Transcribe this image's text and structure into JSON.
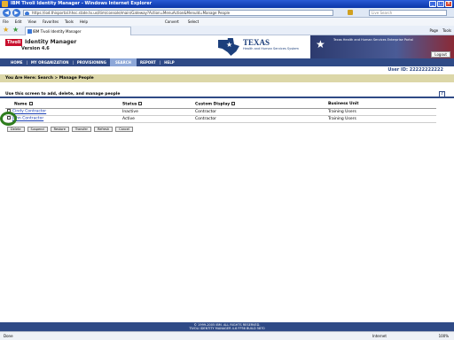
{
  "window": {
    "title": "IBM Tivoli Identity Manager - Windows Internet Explorer"
  },
  "browser": {
    "url": "https://iod.thisportal.hhsc.state.tx.us/itim/console/main/Gateway?Action=MenuAction&MenuId=Manage People",
    "search_placeholder": "Live Search",
    "menu": [
      "File",
      "Edit",
      "View",
      "Favorites",
      "Tools",
      "Help"
    ],
    "toolbar": [
      "Convert",
      "Select"
    ],
    "tab_title": "IBM Tivoli Identity Manager",
    "commands": [
      "Page",
      "Tools"
    ]
  },
  "header": {
    "brand": "Tivoli",
    "app_title": "Identity Manager",
    "version": "Version 4.6",
    "texas_title": "TEXAS",
    "texas_sub": "Health and Human Services System",
    "banner_text": "Texas Health and Human Services Enterprise Portal",
    "logout": "Logout"
  },
  "nav": {
    "items": [
      "HOME",
      "MY ORGANIZATION",
      "PROVISIONING",
      "SEARCH",
      "REPORT",
      "HELP"
    ]
  },
  "user_id": "User ID: 22222222222",
  "breadcrumb": "You Are Here: Search > Manage People",
  "description": "Use this screen to add, delete, and manage people",
  "table": {
    "headers": [
      "Name",
      "Status",
      "Custom Display",
      "Business Unit"
    ],
    "rows": [
      {
        "name": "Cindy Contractor",
        "status": "Inactive",
        "custom": "Contractor",
        "unit": "Training Users"
      },
      {
        "name": "John Contractor",
        "status": "Active",
        "custom": "Contractor",
        "unit": "Training Users"
      }
    ]
  },
  "buttons": [
    "Delete",
    "Suspend",
    "Restore",
    "Transfer",
    "Refresh",
    "Cancel"
  ],
  "footer": {
    "line1": "© 1999-2005 IBM. ALL RIGHTS RESERVED.",
    "line2": "TIVOLI IDENTITY MANAGER 4.6 FP36 BUILD 5870"
  },
  "status": {
    "left": "Done",
    "zone": "Internet",
    "zoom": "100%"
  }
}
